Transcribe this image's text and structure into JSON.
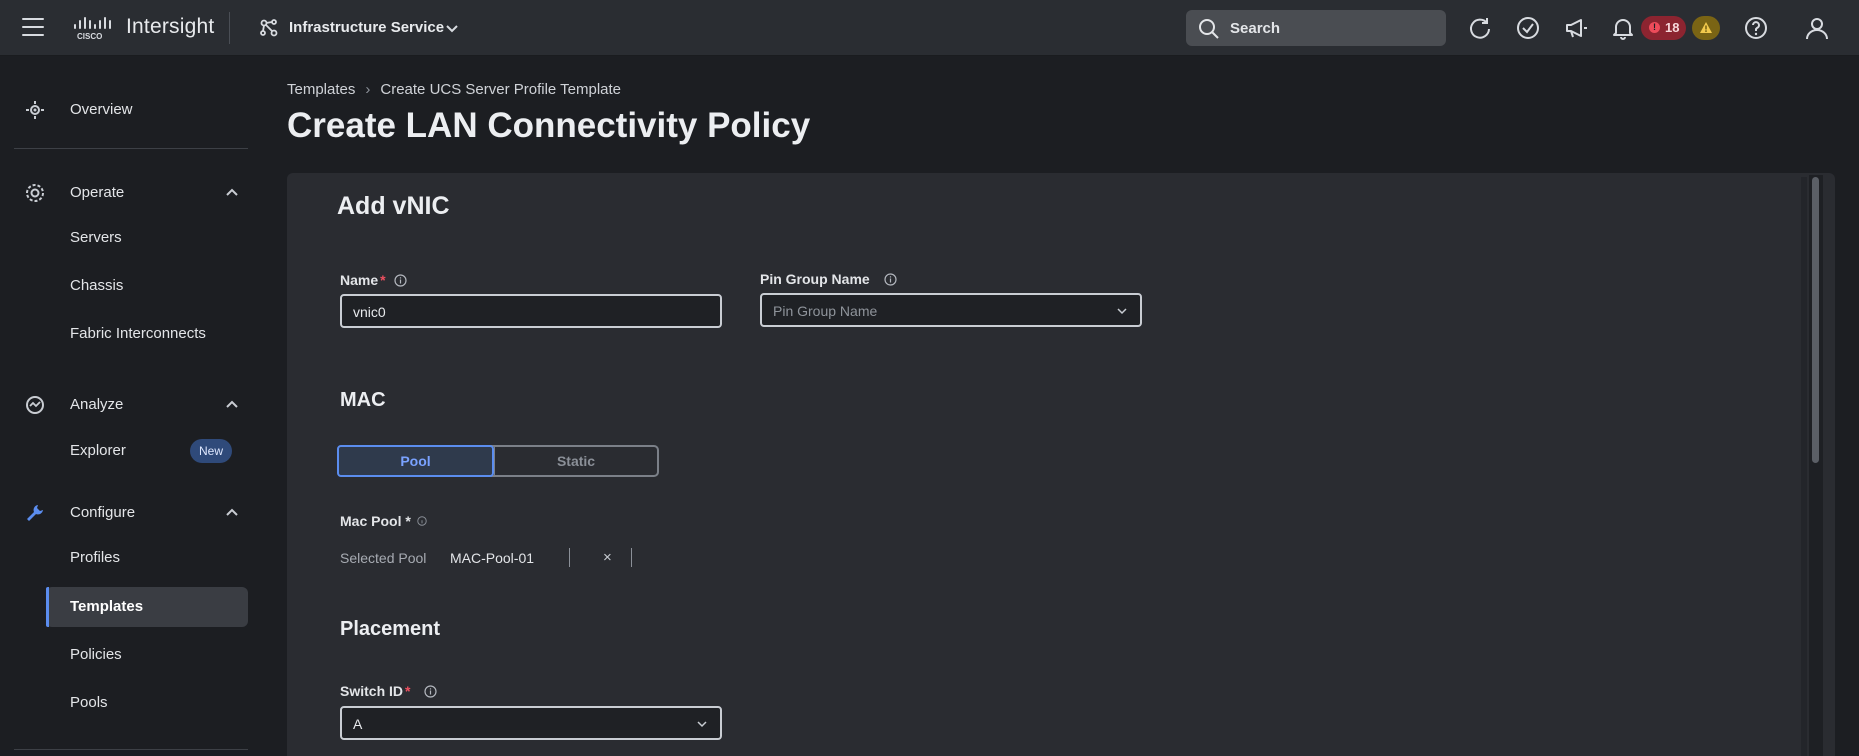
{
  "app": {
    "name": "Intersight",
    "logo": "cisco"
  },
  "header": {
    "service": "Infrastructure Service",
    "search_label": "Search",
    "alerts_count": "18",
    "icons": [
      "refresh-icon",
      "check-circle-icon",
      "megaphone-icon",
      "bell-icon",
      "warning-icon",
      "help-icon",
      "user-icon"
    ]
  },
  "sidebar": {
    "overview": "Overview",
    "operate": {
      "label": "Operate",
      "items": [
        "Servers",
        "Chassis",
        "Fabric Interconnects"
      ]
    },
    "analyze": {
      "label": "Analyze",
      "items": [
        "Explorer"
      ],
      "new_badge": "New"
    },
    "configure": {
      "label": "Configure",
      "items": [
        "Profiles",
        "Templates",
        "Policies",
        "Pools"
      ],
      "active": "Templates"
    }
  },
  "breadcrumb": {
    "items": [
      "Templates",
      "Create UCS Server Profile Template"
    ]
  },
  "page": {
    "title": "Create LAN Connectivity Policy"
  },
  "form": {
    "title": "Add vNIC",
    "name": {
      "label": "Name",
      "required": "*",
      "value": "vnic0"
    },
    "pin_group": {
      "label": "Pin Group Name",
      "placeholder": "Pin Group Name"
    },
    "mac": {
      "title": "MAC",
      "options": [
        "Pool",
        "Static"
      ],
      "selected": "Pool",
      "mac_pool_label": "Mac Pool *",
      "selected_pool_label": "Selected Pool",
      "selected_pool_value": "MAC-Pool-01",
      "clear": "×"
    },
    "placement": {
      "title": "Placement",
      "switch_id": {
        "label": "Switch ID",
        "required": "*",
        "value": "A"
      }
    }
  },
  "colors": {
    "accent": "#5b8def",
    "required": "#ee5060",
    "alert": "#8c2430",
    "warning": "#7a6414"
  }
}
